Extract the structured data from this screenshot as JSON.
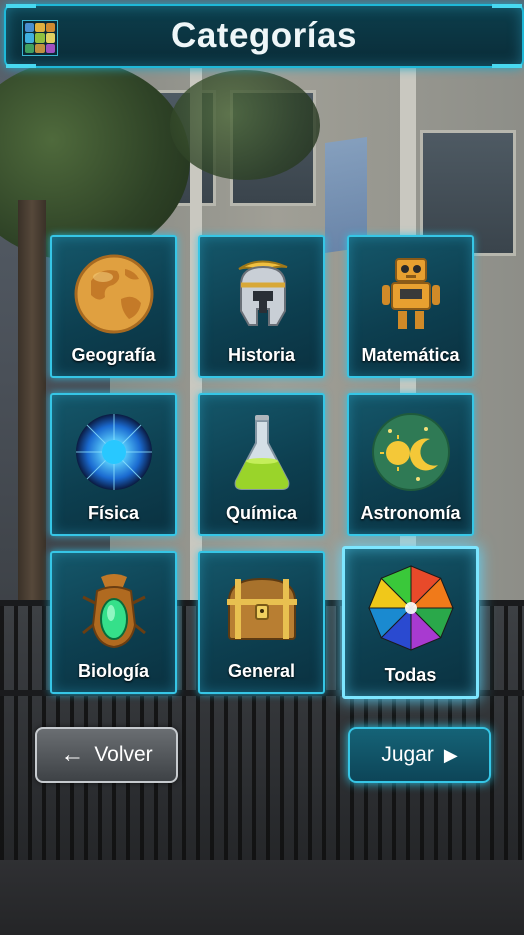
{
  "header": {
    "title": "Categorías"
  },
  "categories": [
    {
      "label": "Geografía",
      "icon": "globe-icon"
    },
    {
      "label": "Historia",
      "icon": "helmet-icon"
    },
    {
      "label": "Matemática",
      "icon": "robot-icon"
    },
    {
      "label": "Física",
      "icon": "energy-sphere-icon"
    },
    {
      "label": "Química",
      "icon": "flask-icon"
    },
    {
      "label": "Astronomía",
      "icon": "sun-moon-icon"
    },
    {
      "label": "Biología",
      "icon": "scarab-icon"
    },
    {
      "label": "General",
      "icon": "treasure-chest-icon"
    },
    {
      "label": "Todas",
      "icon": "color-wheel-icon",
      "selected": true
    }
  ],
  "buttons": {
    "back_label": "Volver",
    "play_label": "Jugar"
  },
  "colors": {
    "accent": "#36c6e6",
    "tile_bg": "#0d3f50"
  }
}
